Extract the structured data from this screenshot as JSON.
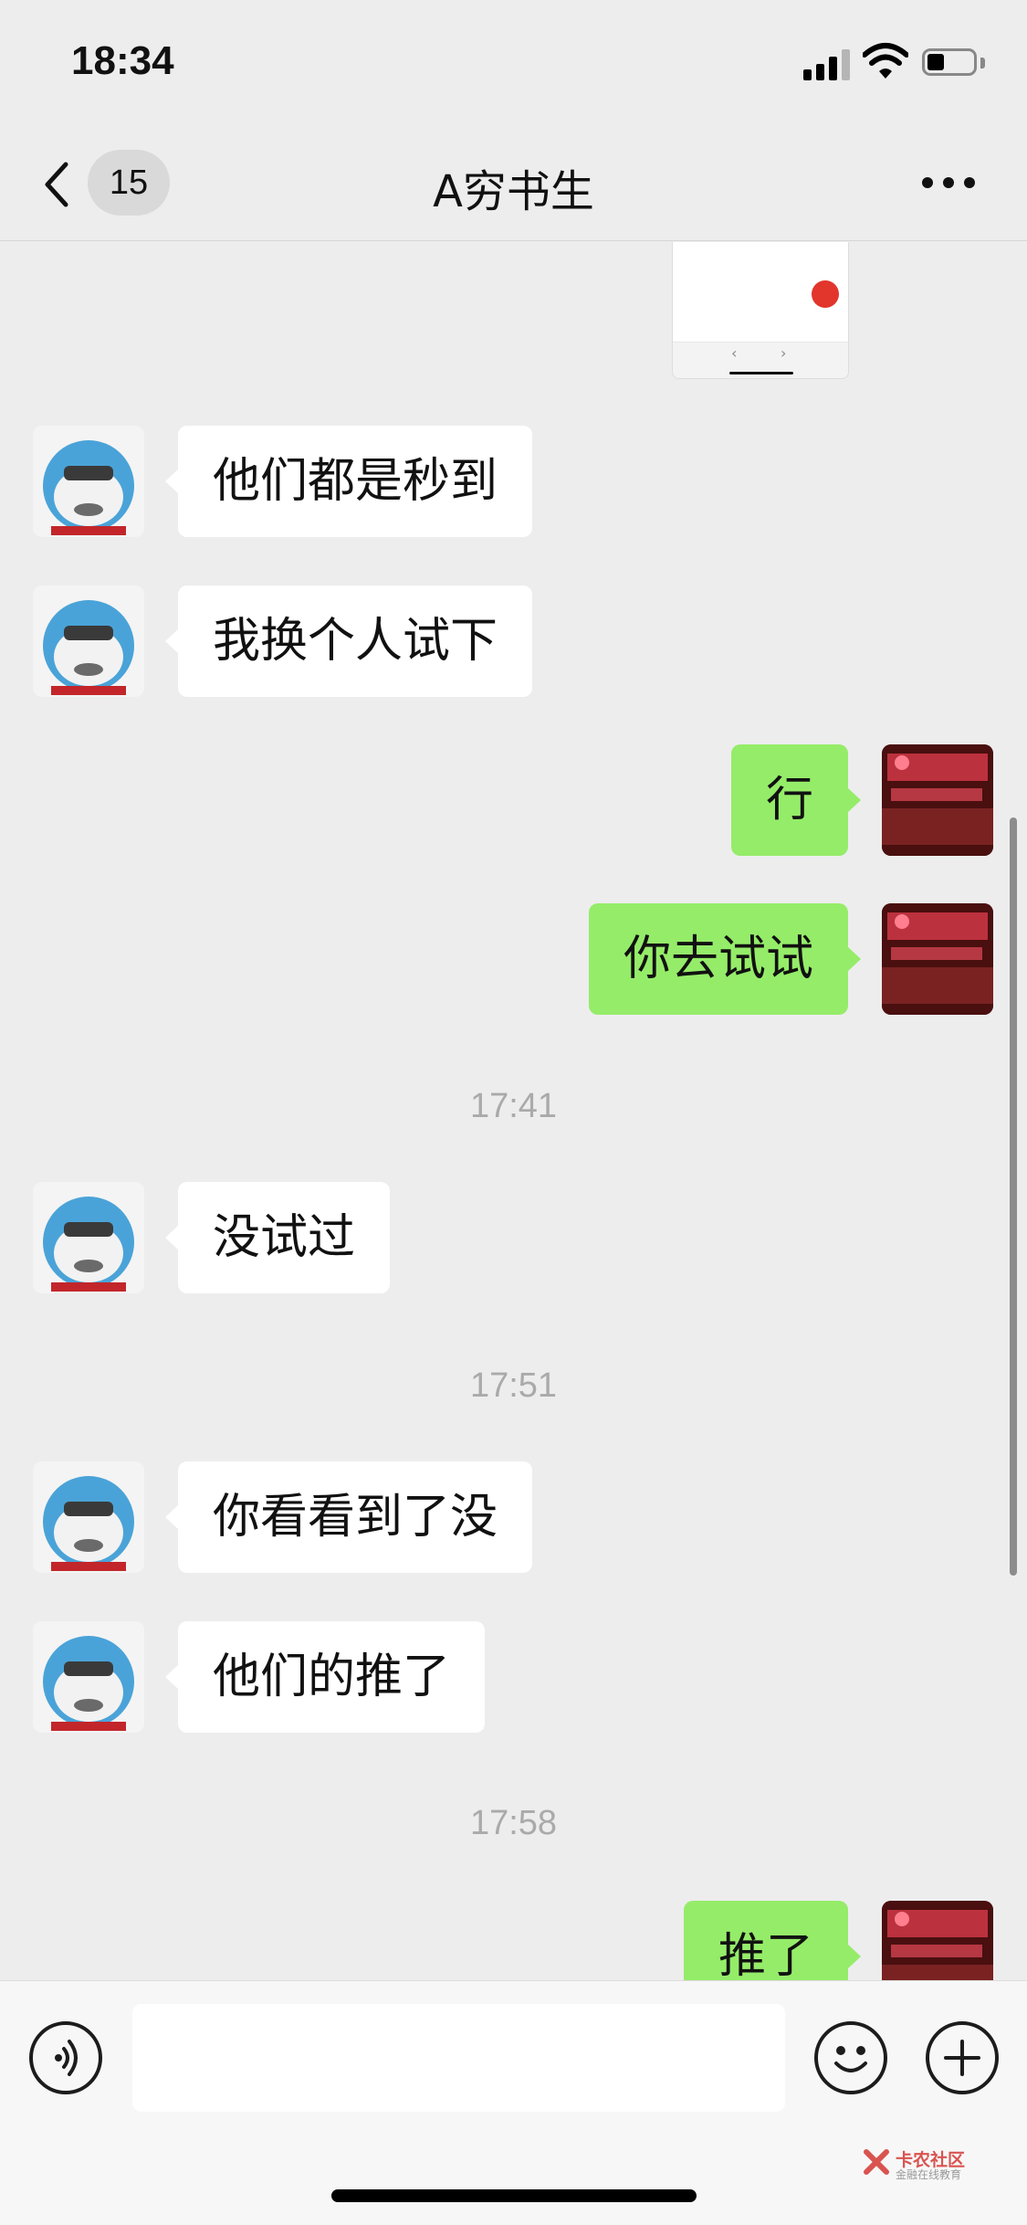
{
  "status_bar": {
    "time": "18:34"
  },
  "header": {
    "unread_count": "15",
    "title": "A穷书生"
  },
  "messages": [
    {
      "side": "in",
      "text": "他们都是秒到"
    },
    {
      "side": "in",
      "text": "我换个人试下"
    },
    {
      "side": "out",
      "text": "行"
    },
    {
      "side": "out",
      "text": "你去试试"
    },
    {
      "timestamp": "17:41"
    },
    {
      "side": "in",
      "text": "没试过"
    },
    {
      "timestamp": "17:51"
    },
    {
      "side": "in",
      "text": "你看看到了没"
    },
    {
      "side": "in",
      "text": "他们的推了"
    },
    {
      "timestamp": "17:58"
    },
    {
      "side": "out",
      "text": "推了"
    }
  ],
  "image_preview": {
    "prev": "‹",
    "next": "›"
  },
  "input": {
    "placeholder": ""
  },
  "watermark": {
    "title": "卡农社区",
    "subtitle": "金融在线教育"
  },
  "colors": {
    "background": "#ededed",
    "outgoing_bubble": "#95ec69",
    "incoming_bubble": "#ffffff",
    "timestamp": "#aaaaaa"
  },
  "icons": [
    "back-arrow-icon",
    "more-dots-icon",
    "voice-icon",
    "emoji-icon",
    "plus-icon",
    "signal-icon",
    "wifi-icon",
    "battery-icon"
  ]
}
